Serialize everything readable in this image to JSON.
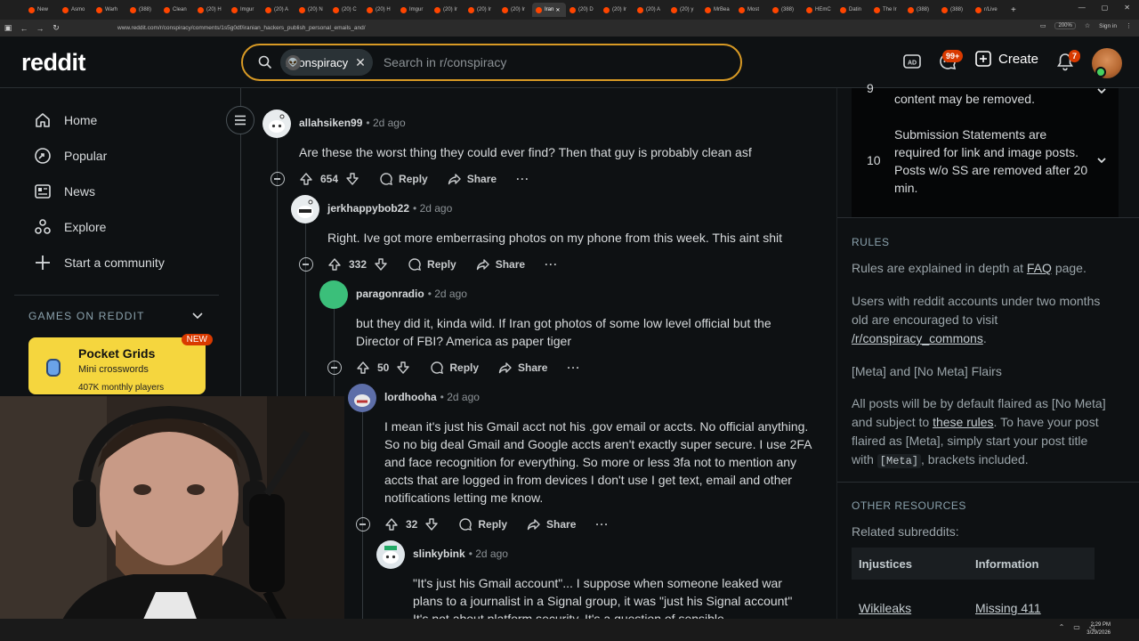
{
  "browser": {
    "tabs": [
      {
        "label": "New"
      },
      {
        "label": "Asmo"
      },
      {
        "label": "Warh"
      },
      {
        "label": "(388)"
      },
      {
        "label": "Clean"
      },
      {
        "label": "(20) H"
      },
      {
        "label": "Imgur"
      },
      {
        "label": "(20) A"
      },
      {
        "label": "(20) N"
      },
      {
        "label": "(20) C"
      },
      {
        "label": "(20) H"
      },
      {
        "label": "Imgur"
      },
      {
        "label": "(20) Ir"
      },
      {
        "label": "(20) Ir"
      },
      {
        "label": "(20) Ir"
      },
      {
        "label": "Iran",
        "active": true
      },
      {
        "label": "(20) D"
      },
      {
        "label": "(20) Ir"
      },
      {
        "label": "(20) A"
      },
      {
        "label": "(20) y"
      },
      {
        "label": "MrBea"
      },
      {
        "label": "Most"
      },
      {
        "label": "(388)"
      },
      {
        "label": "HEmC"
      },
      {
        "label": "Datin"
      },
      {
        "label": "The Ir"
      },
      {
        "label": "(388)"
      },
      {
        "label": "(388)"
      },
      {
        "label": "r/Live"
      }
    ],
    "url": "www.reddit.com/r/conspiracy/comments/1s5g0df/iranian_hackers_publish_personal_emails_and/",
    "zoom": "200%",
    "signin": "Sign in"
  },
  "header": {
    "logo": "reddit",
    "search_chip": "r/conspiracy",
    "search_placeholder": "Search in r/conspiracy",
    "chat_badge": "99+",
    "create_label": "Create",
    "notif_badge": "7"
  },
  "leftnav": {
    "items": [
      {
        "label": "Home",
        "icon": "home-icon"
      },
      {
        "label": "Popular",
        "icon": "popular-icon"
      },
      {
        "label": "News",
        "icon": "news-icon"
      },
      {
        "label": "Explore",
        "icon": "explore-icon"
      },
      {
        "label": "Start a community",
        "icon": "plus-icon"
      }
    ],
    "games_heading": "GAMES ON REDDIT",
    "game": {
      "title": "Pocket Grids",
      "subtitle": "Mini crosswords",
      "players": "407K monthly players",
      "badge": "NEW"
    }
  },
  "comments": [
    {
      "user": "allahsiken99",
      "time": "2d ago",
      "text": "Are these the worst thing they could ever find? Then that guy is probably clean asf",
      "votes": "654",
      "reply": "Reply",
      "share": "Share"
    },
    {
      "user": "jerkhappybob22",
      "time": "2d ago",
      "text": "Right. Ive got more emberrasing photos on my phone from this week. This aint shit",
      "votes": "332",
      "reply": "Reply",
      "share": "Share"
    },
    {
      "user": "paragonradio",
      "time": "2d ago",
      "text": "but they did it, kinda wild. If Iran got photos of some low level official but the Director of FBI? America as paper tiger",
      "votes": "50",
      "reply": "Reply",
      "share": "Share"
    },
    {
      "user": "lordhooha",
      "time": "2d ago",
      "text": "I mean it's just his Gmail acct not his .gov email or accts. No official anything. So no big deal Gmail and Google accts aren't exactly super secure. I use 2FA and face recognition for everything. So more or less 3fa not to mention any accts that are logged in from devices I don't use I get text, email and other notifications letting me know.",
      "votes": "32",
      "reply": "Reply",
      "share": "Share"
    },
    {
      "user": "slinkybink",
      "time": "2d ago",
      "text": "\"It's just his Gmail account\"... I suppose when someone leaked war plans to a journalist in a Signal group, it was \"just his Signal account\" It's not about platform security. It's a question of sensible"
    }
  ],
  "sidebar": {
    "rule9_partial": "content may be removed.",
    "rule10_num": "10",
    "rule10_text": "Submission Statements are required for link and image posts. Posts w/o SS are removed after 20 min.",
    "rules_heading": "RULES",
    "rules_line1_a": "Rules are explained in depth at ",
    "rules_line1_link": "FAQ",
    "rules_line1_b": " page.",
    "rules_line2_a": "Users with reddit accounts under two months old are encouraged to visit ",
    "rules_line2_link": "/r/conspiracy_commons",
    "rules_line2_b": ".",
    "rules_line3": "[Meta] and [No Meta] Flairs",
    "rules_line4_a": "All posts will be by default flaired as [No Meta] and subject to ",
    "rules_line4_link": "these rules",
    "rules_line4_b": ". To have your post flaired as [Meta], simply start your post title with ",
    "rules_line4_code": "[Meta]",
    "rules_line4_c": ", brackets included.",
    "resources_heading": "OTHER RESOURCES",
    "related_label": "Related subreddits:",
    "table_headers": [
      "Injustices",
      "Information"
    ],
    "table_row": [
      "Wikileaks",
      "Missing 411"
    ]
  },
  "taskbar": {
    "time": "2:29 PM",
    "date": "3/29/2026"
  },
  "colors": {
    "background": "#0e1113",
    "search_border": "#d89a25",
    "badge": "#d93a00",
    "game_card": "#f5d63e"
  }
}
